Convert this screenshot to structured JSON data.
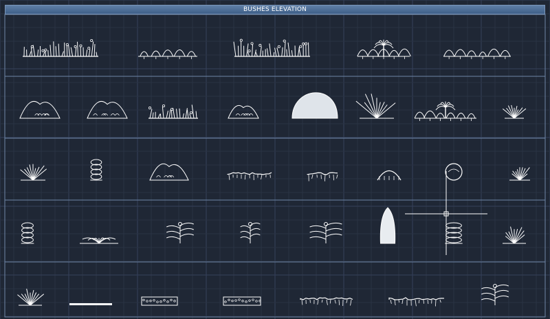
{
  "title": "BUSHES ELEVATION",
  "colors": {
    "background": "#1f2735",
    "grid_minor": "#2a3343",
    "grid_major": "#35405a",
    "frame": "#6f87a8",
    "linework": "#ffffff",
    "title_bar": "#4a6b94"
  },
  "rows": [
    {
      "name": "row-1",
      "blocks": [
        {
          "name": "bush-group-grass-flowers",
          "style": "grass-row"
        },
        {
          "name": "bush-group-mushroom-shrubs",
          "style": "mound-row"
        },
        {
          "name": "bush-group-mixed-hedge",
          "style": "grass-row"
        },
        {
          "name": "bush-group-palm-shrub",
          "style": "palm"
        },
        {
          "name": "bush-group-low-shrubs",
          "style": "mound-row"
        }
      ]
    },
    {
      "name": "row-2",
      "blocks": [
        {
          "name": "bush-rock-mound",
          "style": "mound"
        },
        {
          "name": "bush-rounded-shrub-pair",
          "style": "mound"
        },
        {
          "name": "bush-low-planting",
          "style": "grass-row"
        },
        {
          "name": "bush-boulder-shrub",
          "style": "mound"
        },
        {
          "name": "bush-large-dome",
          "style": "dome"
        },
        {
          "name": "bush-grass-clump",
          "style": "grass"
        },
        {
          "name": "bush-palm-pair",
          "style": "palm"
        },
        {
          "name": "bush-single-spike",
          "style": "grass"
        }
      ]
    },
    {
      "name": "row-3",
      "blocks": [
        {
          "name": "bush-spiky-small",
          "style": "grass"
        },
        {
          "name": "bush-stacked-flower",
          "style": "column"
        },
        {
          "name": "bush-leafy-mound",
          "style": "mound"
        },
        {
          "name": "bush-hanging-hedge",
          "style": "hedge"
        },
        {
          "name": "bush-wedge-hedge",
          "style": "hedge"
        },
        {
          "name": "bush-weeping-small",
          "style": "weeping"
        },
        {
          "name": "bush-round-topiary",
          "style": "ball"
        },
        {
          "name": "bush-agave",
          "style": "grass"
        }
      ]
    },
    {
      "name": "row-4",
      "blocks": [
        {
          "name": "bush-potted-column",
          "style": "column"
        },
        {
          "name": "bush-spreading-fern",
          "style": "fern"
        },
        {
          "name": "bush-flowering-cluster",
          "style": "flower"
        },
        {
          "name": "bush-tall-flowering",
          "style": "flower"
        },
        {
          "name": "bush-broad-leaf",
          "style": "flower"
        },
        {
          "name": "bush-cypress-column",
          "style": "cypress"
        },
        {
          "name": "bush-layered-shrub",
          "style": "column"
        },
        {
          "name": "bush-small-planter",
          "style": "grass"
        }
      ]
    },
    {
      "name": "row-5",
      "blocks": [
        {
          "name": "bush-low-tuft",
          "style": "grass"
        },
        {
          "name": "bush-ground-cover-line",
          "style": "line"
        },
        {
          "name": "bush-box-hedge",
          "style": "boxhedge"
        },
        {
          "name": "bush-clipped-hedge",
          "style": "boxhedge"
        },
        {
          "name": "bush-long-hedge",
          "style": "hedge"
        },
        {
          "name": "bush-long-hedge-2",
          "style": "hedge"
        },
        {
          "name": "bush-tuft-cluster",
          "style": "flower"
        }
      ]
    }
  ]
}
